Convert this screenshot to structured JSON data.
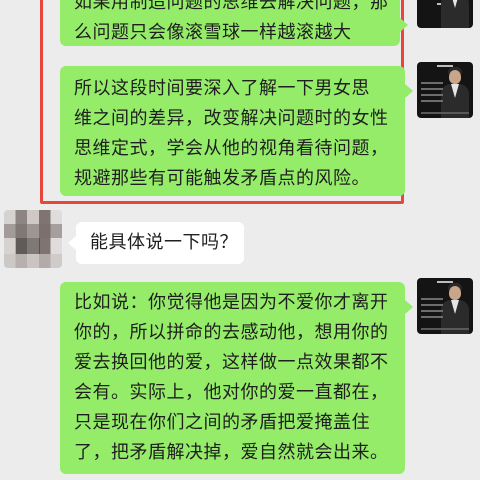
{
  "messages": [
    {
      "id": "msg1",
      "side": "right",
      "lines": [
        "如果用制造问题的思维去解决问题，那",
        "么问题只会像滚雪球一样越滚越大"
      ]
    },
    {
      "id": "msg2",
      "side": "right",
      "lines": [
        "所以这段时间要深入了解一下男女思",
        "维之间的差异，改变解决问题时的女性",
        "思维定式，学会从他的视角看待问题，",
        "规避那些有可能触发矛盾点的风险。"
      ]
    },
    {
      "id": "msg3",
      "side": "left",
      "lines": [
        "能具体说一下吗？"
      ]
    },
    {
      "id": "msg4",
      "side": "right",
      "lines": [
        "比如说：你觉得他是因为不爱你才离开",
        "你的，所以拼命的去感动他，想用你的",
        "爱去换回他的爱，这样做一点效果都不",
        "会有。实际上，他对你的爱一直都在，",
        "只是现在你们之间的矛盾把爱掩盖住",
        "了，把矛盾解决掉，爱自然就会出来。"
      ]
    }
  ],
  "colors": {
    "background": "#ececec",
    "outgoing_bubble": "#95ec69",
    "incoming_bubble": "#ffffff",
    "highlight_border": "#e8463a"
  }
}
